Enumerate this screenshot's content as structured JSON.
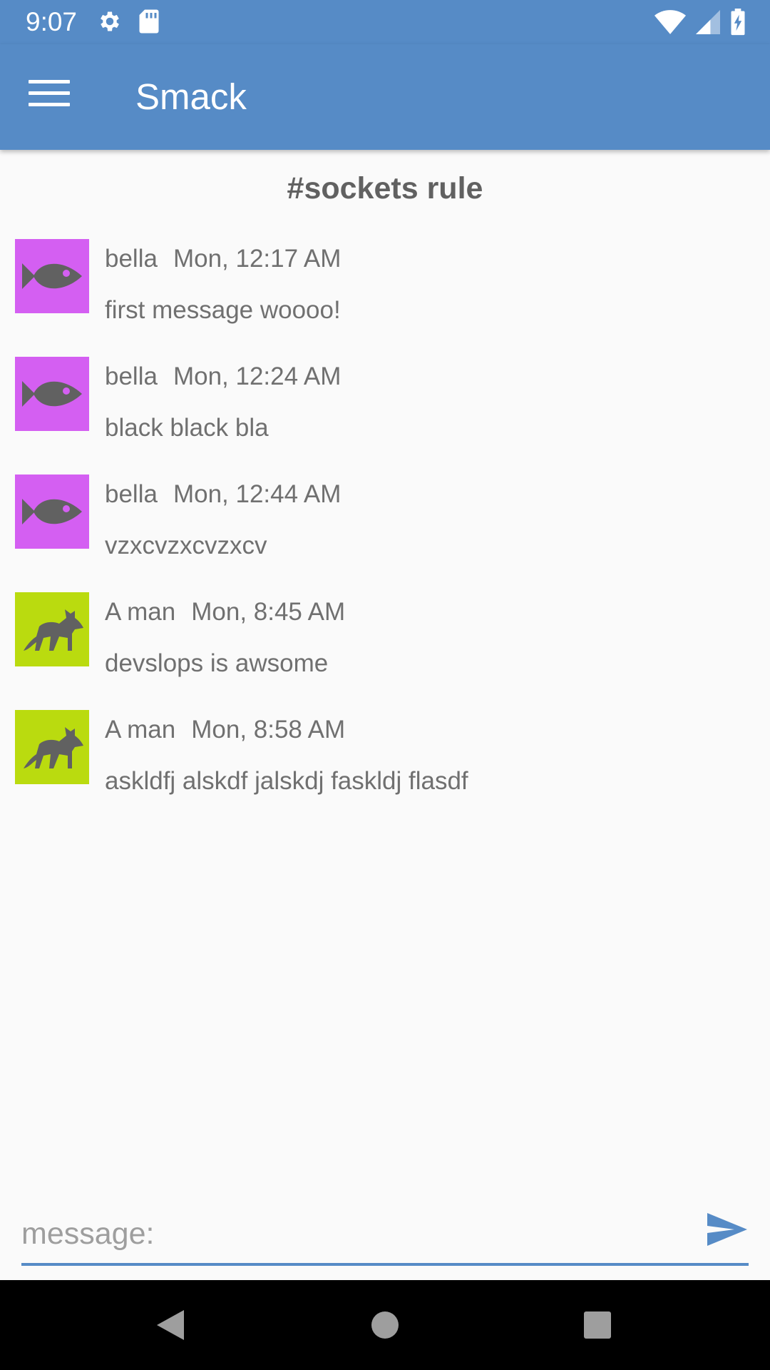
{
  "status_bar": {
    "time": "9:07",
    "left_icons": [
      "gear-icon",
      "sd-card-icon"
    ],
    "right_icons": [
      "wifi-icon",
      "cell-signal-icon",
      "battery-charging-icon"
    ]
  },
  "app_bar": {
    "title": "Smack",
    "menu_icon": "hamburger-menu-icon",
    "background_color": "#568bc6"
  },
  "channel": {
    "name": "#sockets rule"
  },
  "messages": [
    {
      "user": "bella",
      "time": "Mon, 12:17 AM",
      "text": "first message woooo!",
      "avatar": {
        "icon": "fish-icon",
        "color": "#d45ff2"
      }
    },
    {
      "user": "bella",
      "time": "Mon, 12:24 AM",
      "text": "black black bla",
      "avatar": {
        "icon": "fish-icon",
        "color": "#d45ff2"
      }
    },
    {
      "user": "bella",
      "time": "Mon, 12:44 AM",
      "text": "vzxcvzxcvzxcv",
      "avatar": {
        "icon": "fish-icon",
        "color": "#d45ff2"
      }
    },
    {
      "user": "A man",
      "time": "Mon, 8:45 AM",
      "text": "devslops is awsome",
      "avatar": {
        "icon": "fox-icon",
        "color": "#badb0f"
      }
    },
    {
      "user": "A man",
      "time": "Mon, 8:58 AM",
      "text": "askldfj alskdf jalskdj faskldj flasdf",
      "avatar": {
        "icon": "fox-icon",
        "color": "#badb0f"
      }
    }
  ],
  "composer": {
    "placeholder": "message:",
    "value": "",
    "send_icon": "send-icon",
    "accent_color": "#568bc6"
  },
  "nav_bar": {
    "buttons": [
      "back-icon",
      "home-icon",
      "recents-icon"
    ]
  }
}
